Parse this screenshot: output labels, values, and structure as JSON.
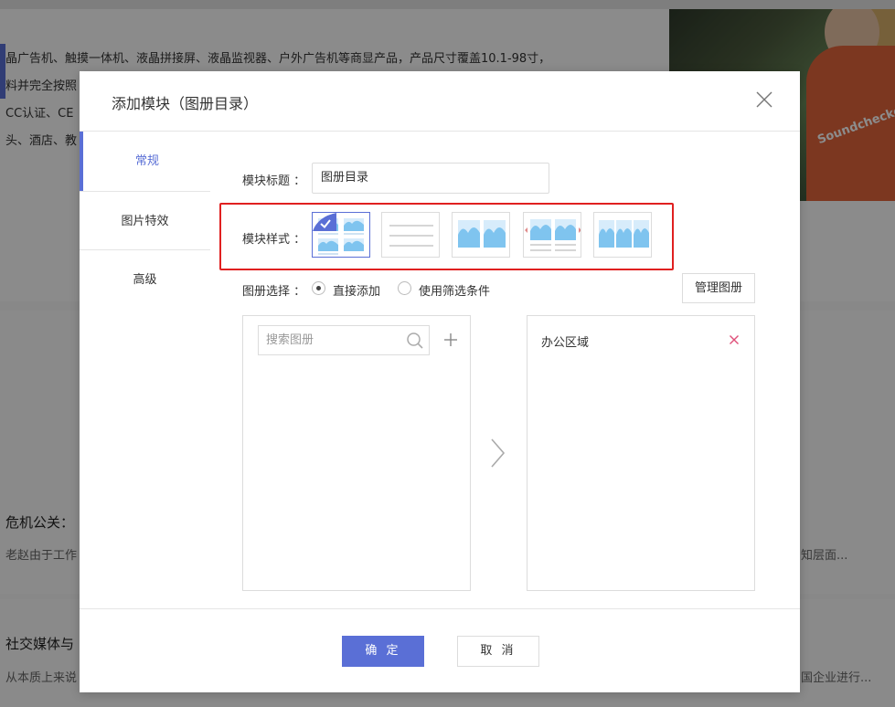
{
  "background": {
    "lines": [
      "晶广告机、触摸一体机、液晶拼接屏、液晶监视器、户外广告机等商显产品，产品尺寸覆盖10.1-98寸，",
      "料并完全按照",
      "CC认证、CE",
      "头、酒店、教"
    ],
    "photo_text": "Soundchecke",
    "article2_title": "危机公关：",
    "article2_sub": "老赵由于工作",
    "article2_right": "知层面...",
    "article3_title": "社交媒体与",
    "article3_sub": "从本质上来说",
    "article3_right": "国企业进行..."
  },
  "modal": {
    "title": "添加模块（图册目录）",
    "tabs": [
      "常规",
      "图片特效",
      "高级"
    ],
    "active_tab": 0,
    "module_title_label": "模块标题 ：",
    "module_title_value": "图册目录",
    "module_style_label": "模块样式 ：",
    "style_options": [
      "grid-4",
      "list-lines",
      "two-column",
      "carousel-captions",
      "carousel-3"
    ],
    "selected_style": 0,
    "album_select_label": "图册选择 ：",
    "radio_direct": "直接添加",
    "radio_filter": "使用筛选条件",
    "radio_selected": "direct",
    "manage_button": "管理图册",
    "search_placeholder": "搜索图册",
    "selected_albums": [
      "办公区域"
    ],
    "ok_button": "确 定",
    "cancel_button": "取 消",
    "accent_color": "#5a6fd6",
    "highlight_color": "#e02020"
  }
}
